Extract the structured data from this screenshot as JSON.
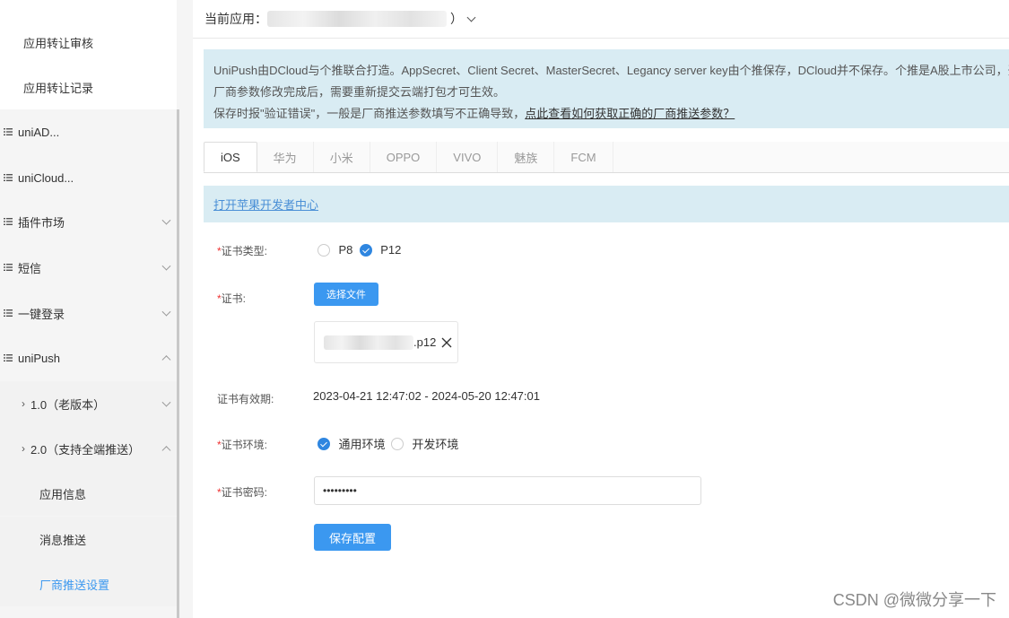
{
  "sidebar": {
    "items": [
      {
        "label": "应用转让审核"
      },
      {
        "label": "应用转让记录"
      },
      {
        "label": "uniAD..."
      },
      {
        "label": "uniCloud..."
      },
      {
        "label": "插件市场"
      },
      {
        "label": "短信"
      },
      {
        "label": "一键登录"
      },
      {
        "label": "uniPush"
      },
      {
        "label": "1.0（老版本）"
      },
      {
        "label": "2.0（支持全端推送）"
      },
      {
        "label": "应用信息"
      },
      {
        "label": "消息推送"
      },
      {
        "label": "厂商推送设置"
      }
    ],
    "active_color": "#3b98f0"
  },
  "header": {
    "current_app_label": "当前应用：",
    "close_paren": "）"
  },
  "notice": {
    "line1": "UniPush由DCloud与个推联合打造。AppSecret、Client Secret、MasterSecret、Legancy server key由个推保存，DCloud并不保存。个推是A股上市公司，开发者",
    "line2": "厂商参数修改完成后，需要重新提交云端打包才可生效。",
    "line3_prefix": "保存时报\"验证错误\"，一般是厂商推送参数填写不正确导致，",
    "line3_link": "点此查看如何获取正确的厂商推送参数？"
  },
  "tabs": [
    "iOS",
    "华为",
    "小米",
    "OPPO",
    "VIVO",
    "魅族",
    "FCM"
  ],
  "dev_center_link": "打开苹果开发者中心",
  "form": {
    "cert_type_label": "证书类型:",
    "cert_type_options": [
      "P8",
      "P12"
    ],
    "cert_label": "证书:",
    "choose_file_button": "选择文件",
    "file_ext": ".p12",
    "validity_label": "证书有效期:",
    "validity_value": "2023-04-21 12:47:02 - 2024-05-20 12:47:01",
    "env_label": "证书环境:",
    "env_options": [
      "通用环境",
      "开发环境"
    ],
    "password_label": "证书密码:",
    "password_value": "•••••••••",
    "save_button": "保存配置"
  },
  "watermark": "CSDN @微微分享一下"
}
